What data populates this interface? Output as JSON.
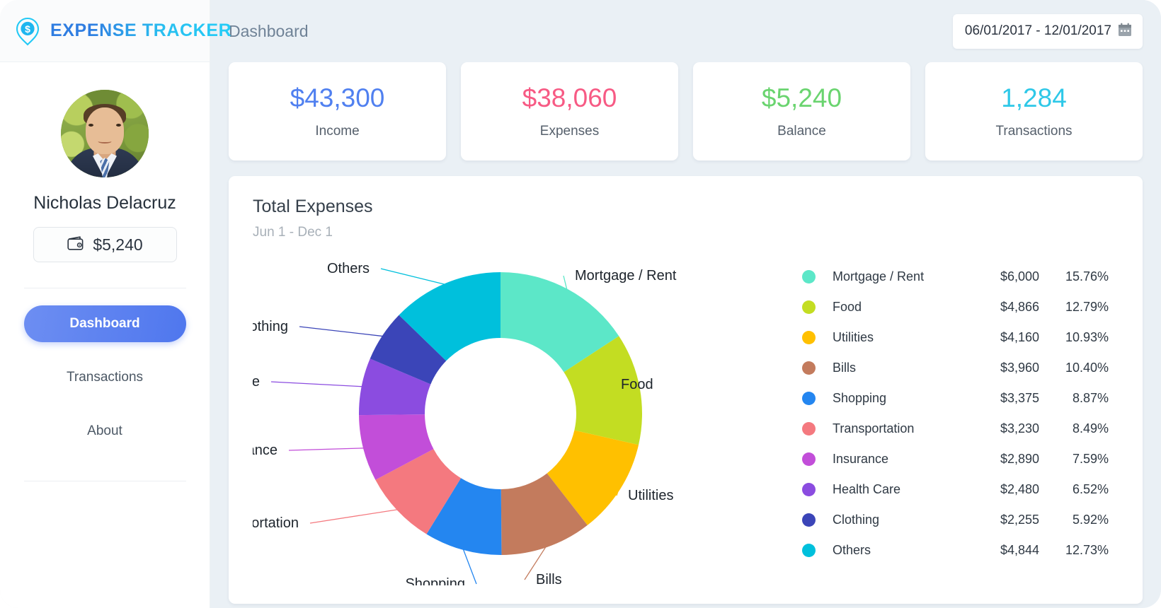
{
  "brand": {
    "name": "EXPENSE TRACKER",
    "logo_icon": "location-pin-dollar-icon",
    "color_start": "#2f7de1",
    "color_end": "#24cdf7"
  },
  "sidebar": {
    "user": {
      "avatar_icon": "user-avatar-photo",
      "name": "Nicholas Delacruz",
      "wallet_icon": "wallet-icon",
      "wallet_amount": "$5,240"
    },
    "nav": [
      {
        "label": "Dashboard",
        "name": "sidebar-item-dashboard",
        "active": true
      },
      {
        "label": "Transactions",
        "name": "sidebar-item-transactions",
        "active": false
      },
      {
        "label": "About",
        "name": "sidebar-item-about",
        "active": false
      }
    ]
  },
  "topbar": {
    "breadcrumb": "Dashboard",
    "date_range": "06/01/2017 - 12/01/2017",
    "calendar_icon": "calendar-icon"
  },
  "stats": [
    {
      "value": "$43,300",
      "label": "Income",
      "color": "#5080f0"
    },
    {
      "value": "$38,060",
      "label": "Expenses",
      "color": "#f75a84"
    },
    {
      "value": "$5,240",
      "label": "Balance",
      "color": "#6ad46f"
    },
    {
      "value": "1,284",
      "label": "Transactions",
      "color": "#2ec8e8"
    }
  ],
  "panel": {
    "title": "Total Expenses",
    "subtitle": "Jun 1 - Dec 1"
  },
  "chart_data": {
    "type": "pie",
    "title": "Total Expenses",
    "subtitle": "Jun 1 - Dec 1",
    "donut": true,
    "legend_position": "right",
    "categories": [
      "Mortgage / Rent",
      "Food",
      "Utilities",
      "Bills",
      "Shopping",
      "Transportation",
      "Insurance",
      "Health Care",
      "Clothing",
      "Others"
    ],
    "values": [
      6000,
      4866,
      4160,
      3960,
      3375,
      3230,
      2890,
      2480,
      2255,
      4844
    ],
    "percents": [
      15.76,
      12.79,
      10.93,
      10.4,
      8.87,
      8.49,
      7.59,
      6.52,
      5.92,
      12.73
    ],
    "amount_labels": [
      "$6,000",
      "$4,866",
      "$4,160",
      "$3,960",
      "$3,375",
      "$3,230",
      "$2,890",
      "$2,480",
      "$2,255",
      "$4,844"
    ],
    "percent_labels": [
      "15.76%",
      "12.79%",
      "10.93%",
      "10.40%",
      "8.87%",
      "8.49%",
      "7.59%",
      "6.52%",
      "5.92%",
      "12.73%"
    ],
    "colors": [
      "#5ce7c8",
      "#c3dd22",
      "#ffc000",
      "#c37b5d",
      "#2486f0",
      "#f4797f",
      "#c24ed9",
      "#8b4ce0",
      "#3b45b8",
      "#00c0dc"
    ],
    "slice_labels": [
      "Mortgage / Rent",
      "Food",
      "Utilities",
      "Bills",
      "Shopping",
      "Transportation",
      "Insurance",
      "Health Care",
      "Clothing",
      "Others"
    ]
  },
  "legend": [
    {
      "name": "Mortgage / Rent",
      "amount": "$6,000",
      "percent": "15.76%",
      "color": "#5ce7c8"
    },
    {
      "name": "Food",
      "amount": "$4,866",
      "percent": "12.79%",
      "color": "#c3dd22"
    },
    {
      "name": "Utilities",
      "amount": "$4,160",
      "percent": "10.93%",
      "color": "#ffc000"
    },
    {
      "name": "Bills",
      "amount": "$3,960",
      "percent": "10.40%",
      "color": "#c37b5d"
    },
    {
      "name": "Shopping",
      "amount": "$3,375",
      "percent": "8.87%",
      "color": "#2486f0"
    },
    {
      "name": "Transportation",
      "amount": "$3,230",
      "percent": "8.49%",
      "color": "#f4797f"
    },
    {
      "name": "Insurance",
      "amount": "$2,890",
      "percent": "7.59%",
      "color": "#c24ed9"
    },
    {
      "name": "Health Care",
      "amount": "$2,480",
      "percent": "6.52%",
      "color": "#8b4ce0"
    },
    {
      "name": "Clothing",
      "amount": "$2,255",
      "percent": "5.92%",
      "color": "#3b45b8"
    },
    {
      "name": "Others",
      "amount": "$4,844",
      "percent": "12.73%",
      "color": "#00c0dc"
    }
  ]
}
